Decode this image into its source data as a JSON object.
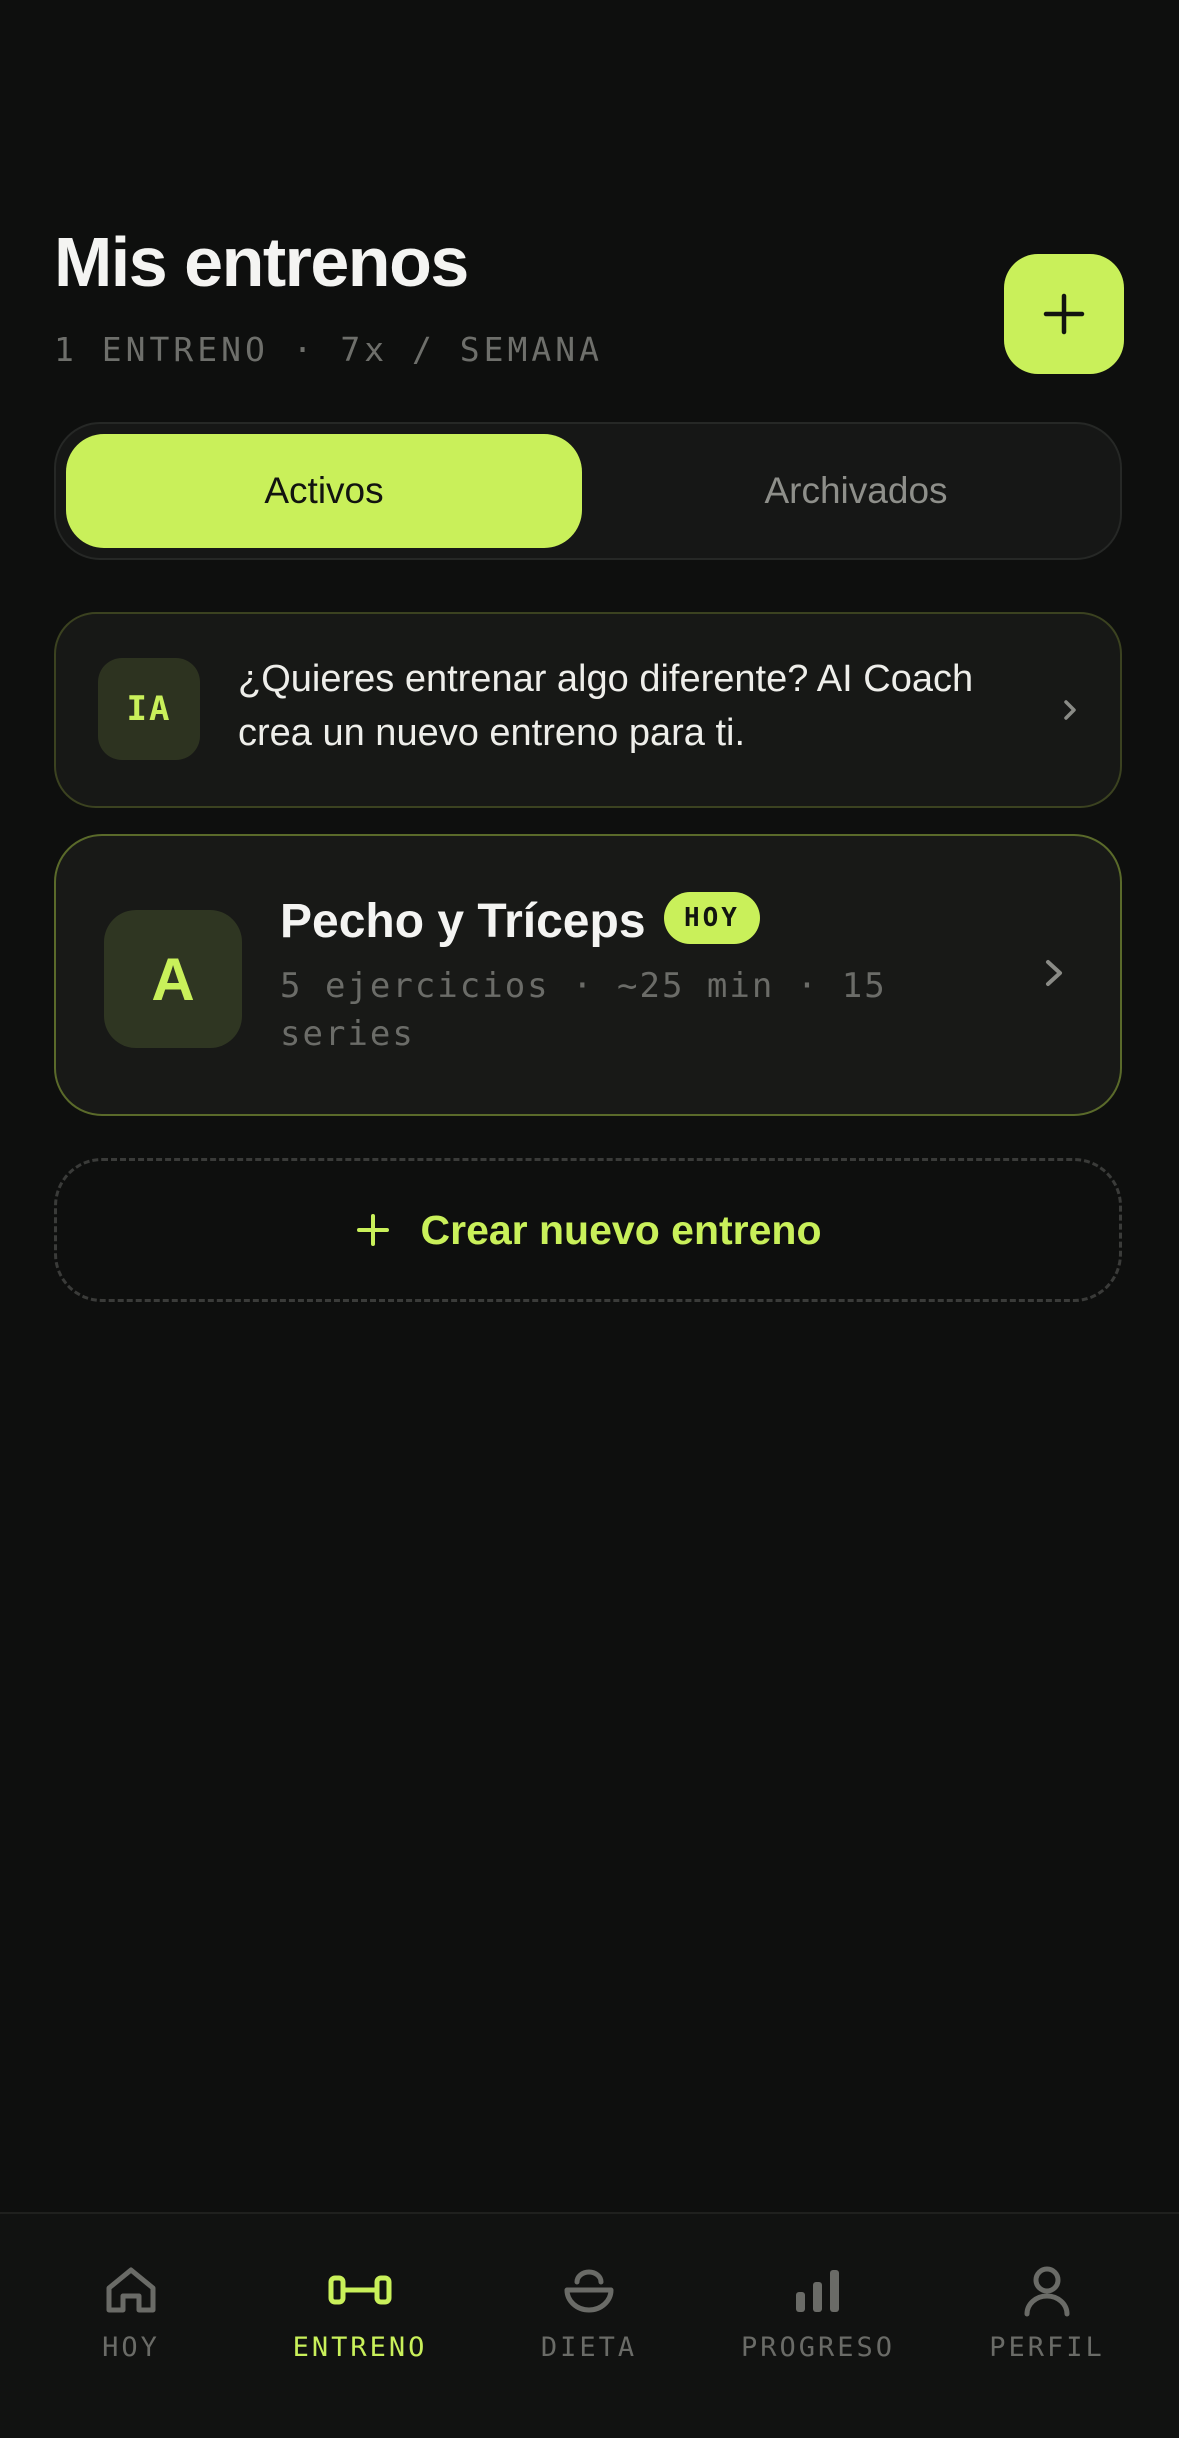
{
  "header": {
    "title": "Mis entrenos",
    "subtitle": "1 ENTRENO · 7x / SEMANA",
    "add_icon": "plus-icon"
  },
  "segments": {
    "active_label": "Activos",
    "archived_label": "Archivados",
    "selected": "Activos"
  },
  "ai_card": {
    "badge": "IA",
    "text": "¿Quieres entrenar algo diferente? AI Coach crea un nuevo entreno para ti.",
    "icon": "chevron-right-icon"
  },
  "workouts": [
    {
      "letter": "A",
      "name": "Pecho y Tríceps",
      "badge": "HOY",
      "meta": "5 ejercicios · ~25 min · 15 series"
    }
  ],
  "create": {
    "label": "Crear nuevo entreno",
    "icon": "plus-icon"
  },
  "tabbar": {
    "items": [
      {
        "label": "HOY",
        "icon": "home-icon"
      },
      {
        "label": "ENTRENO",
        "icon": "dumbbell-icon"
      },
      {
        "label": "DIETA",
        "icon": "bowl-icon"
      },
      {
        "label": "PROGRESO",
        "icon": "bar-chart-icon"
      },
      {
        "label": "PERFIL",
        "icon": "user-icon"
      }
    ],
    "active": "ENTRENO"
  },
  "colors": {
    "accent": "#c9f05a",
    "background": "#0e0f0e",
    "muted": "#6e6f6b"
  }
}
